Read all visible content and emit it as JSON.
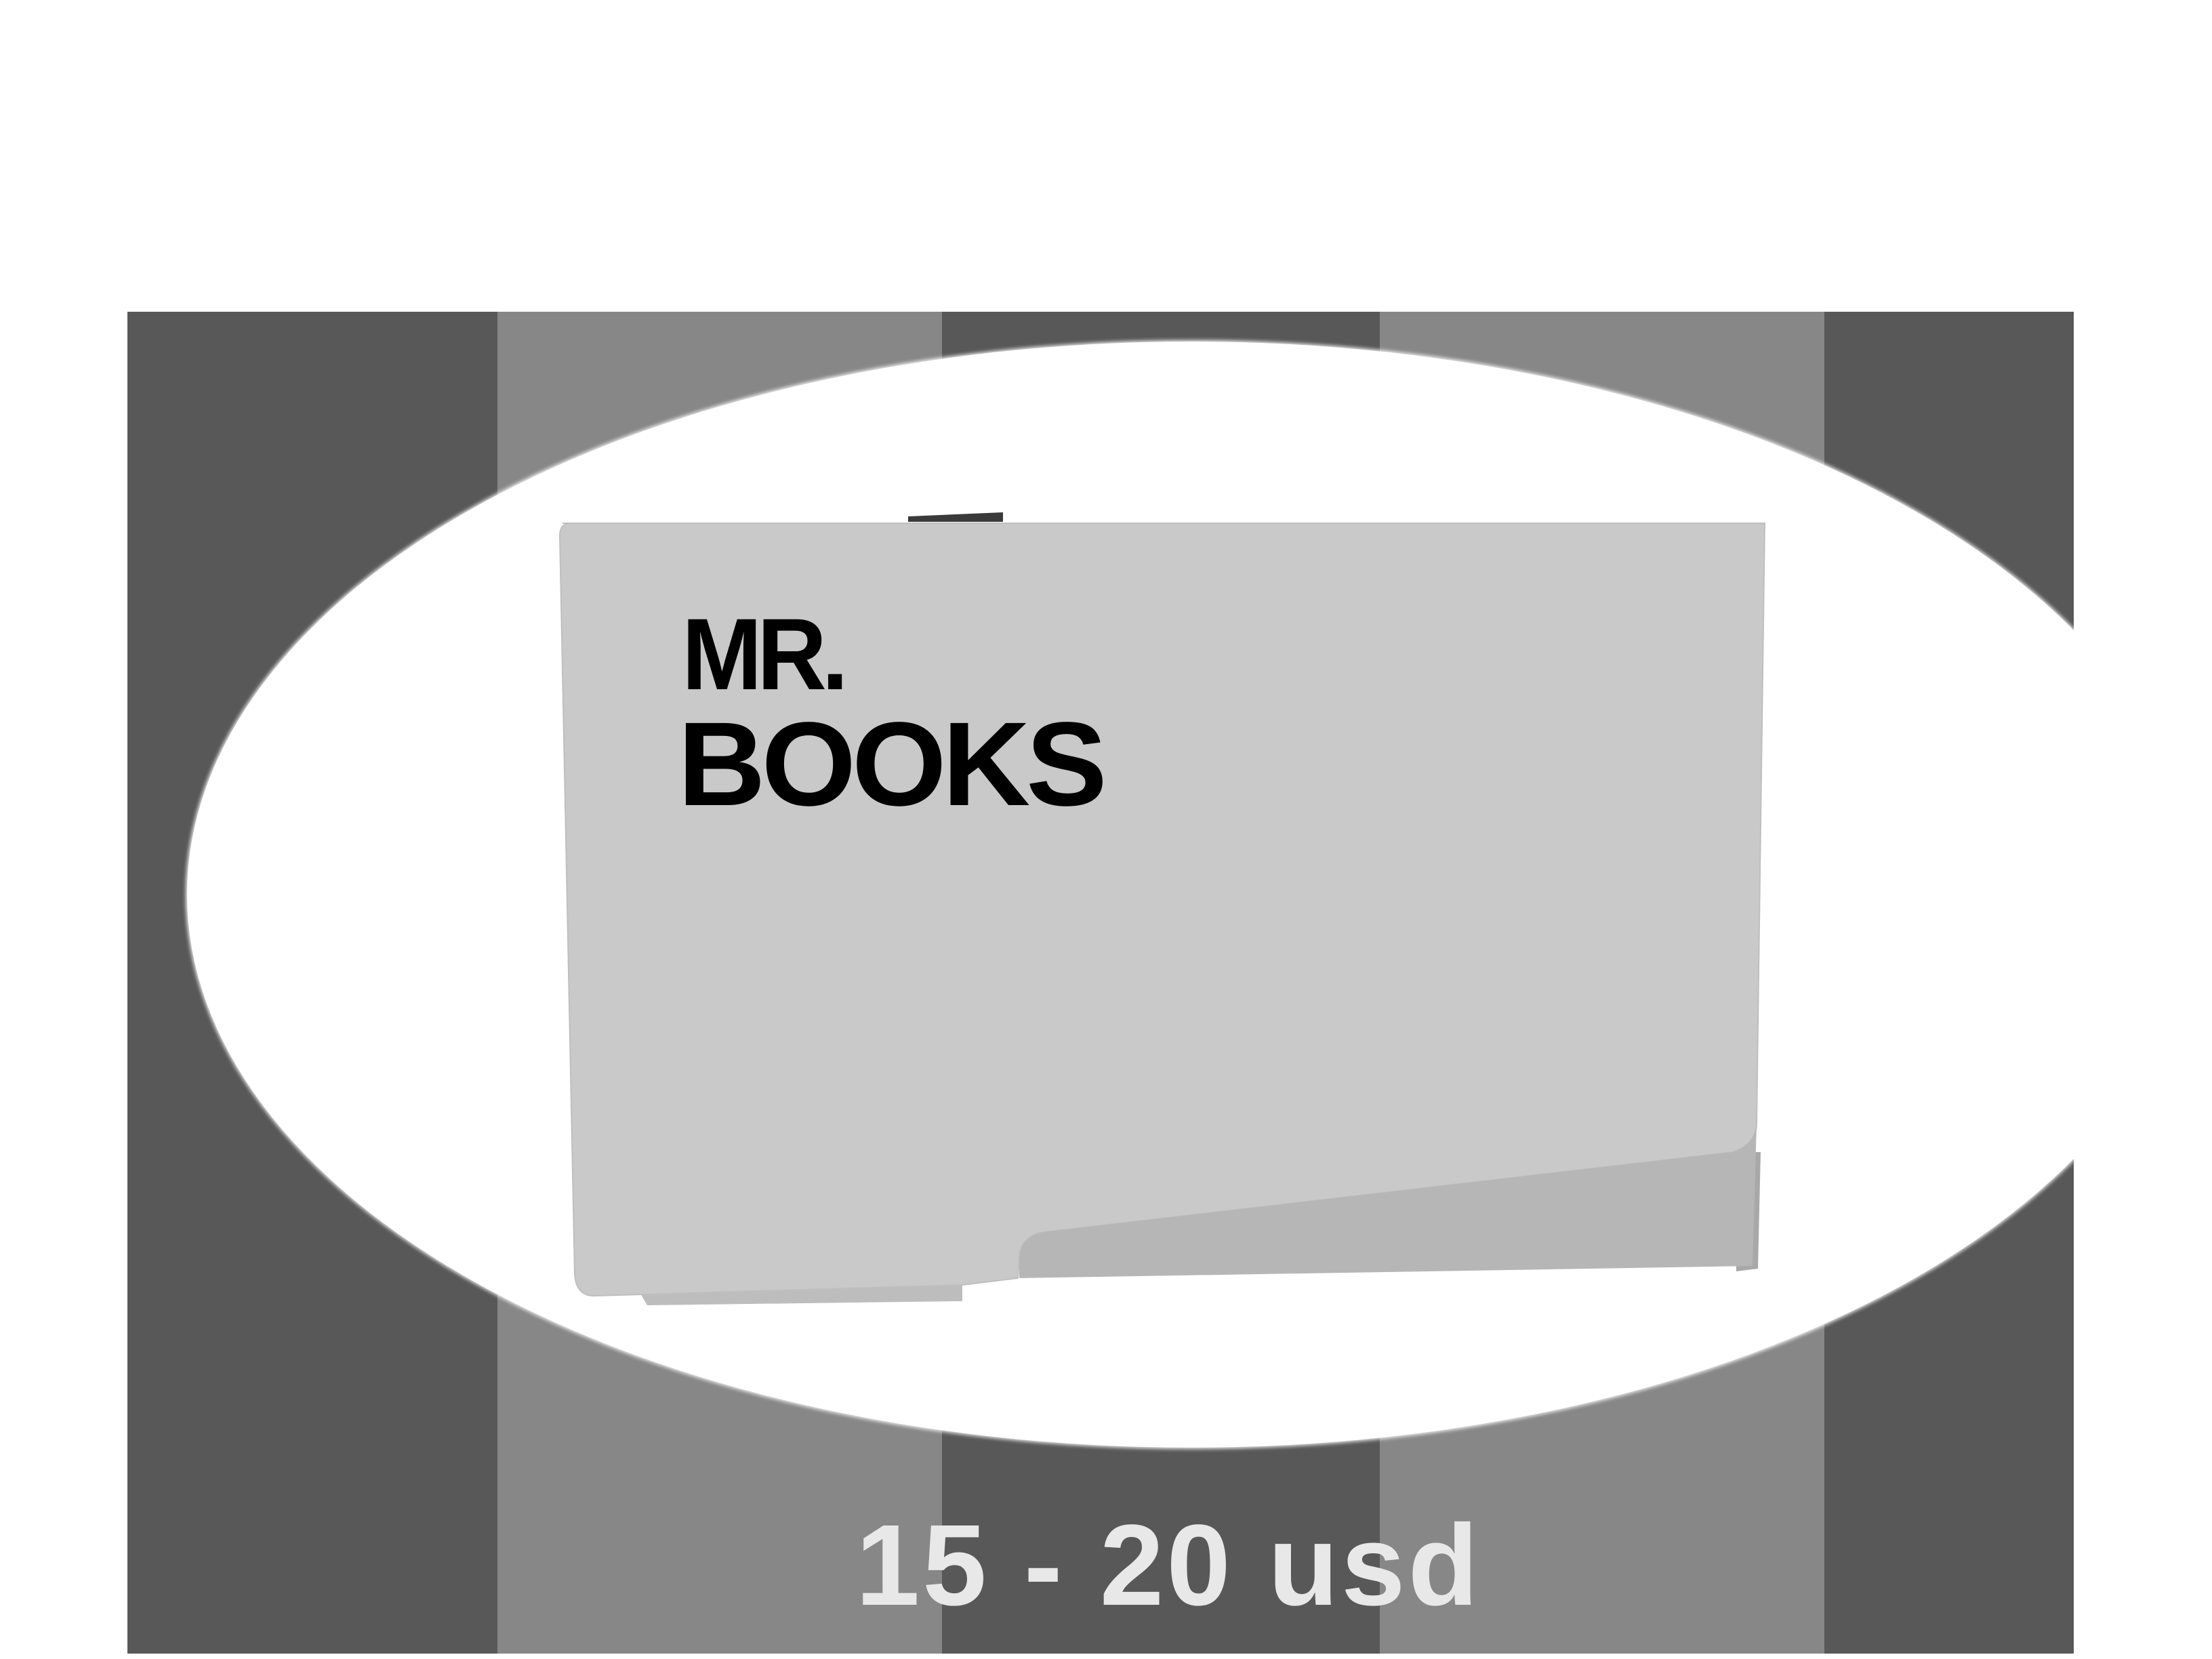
{
  "brand": {
    "line1": "MR.",
    "line2": "BOOKS"
  },
  "price": {
    "label": "15 - 20 usd"
  },
  "colors": {
    "dark_stripe": "#585858",
    "light_stripe": "#878787",
    "oval": "#ffffff",
    "card_face": "#c9c9c9",
    "card_edge": "#b6b6b6",
    "logo": "#000000",
    "price_text": "#e8e8e8"
  }
}
